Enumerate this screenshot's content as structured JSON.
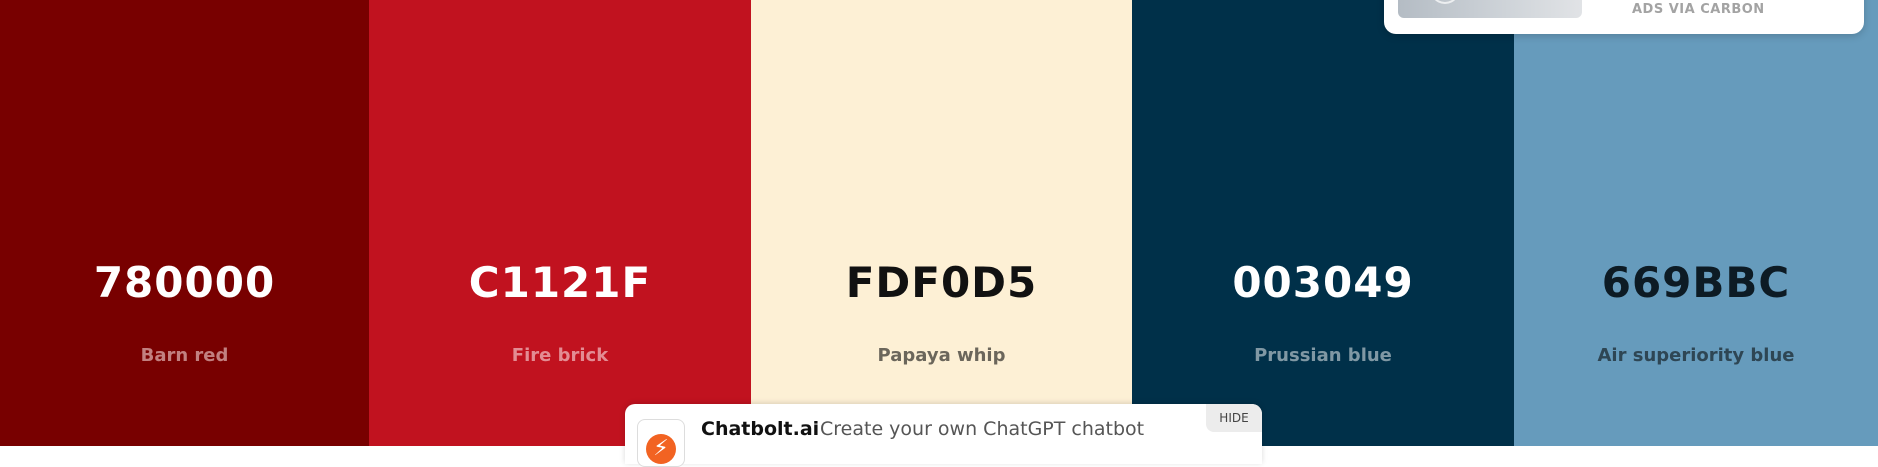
{
  "palette": {
    "colors": [
      {
        "hex": "780000",
        "name": "Barn red",
        "bg": "#780000",
        "text_color": "#ffffff",
        "name_color": "#c28080"
      },
      {
        "hex": "C1121F",
        "name": "Fire brick",
        "bg": "#C1121F",
        "text_color": "#ffffff",
        "name_color": "#e38c93"
      },
      {
        "hex": "FDF0D5",
        "name": "Papaya whip",
        "bg": "#FDF0D5",
        "text_color": "#111111",
        "name_color": "#6b665b"
      },
      {
        "hex": "003049",
        "name": "Prussian blue",
        "bg": "#003049",
        "text_color": "#ffffff",
        "name_color": "#8098a4"
      },
      {
        "hex": "669BBC",
        "name": "Air superiority blue",
        "bg": "#669BBC",
        "text_color": "#0d1b24",
        "name_color": "#2e4654"
      }
    ]
  },
  "carbon_ad": {
    "via_label": "ADS VIA CARBON"
  },
  "promo": {
    "brand": "Chatbolt.ai",
    "tagline": "Create your own ChatGPT chatbot",
    "hide_label": "HIDE",
    "logo_color": "#f26322"
  }
}
